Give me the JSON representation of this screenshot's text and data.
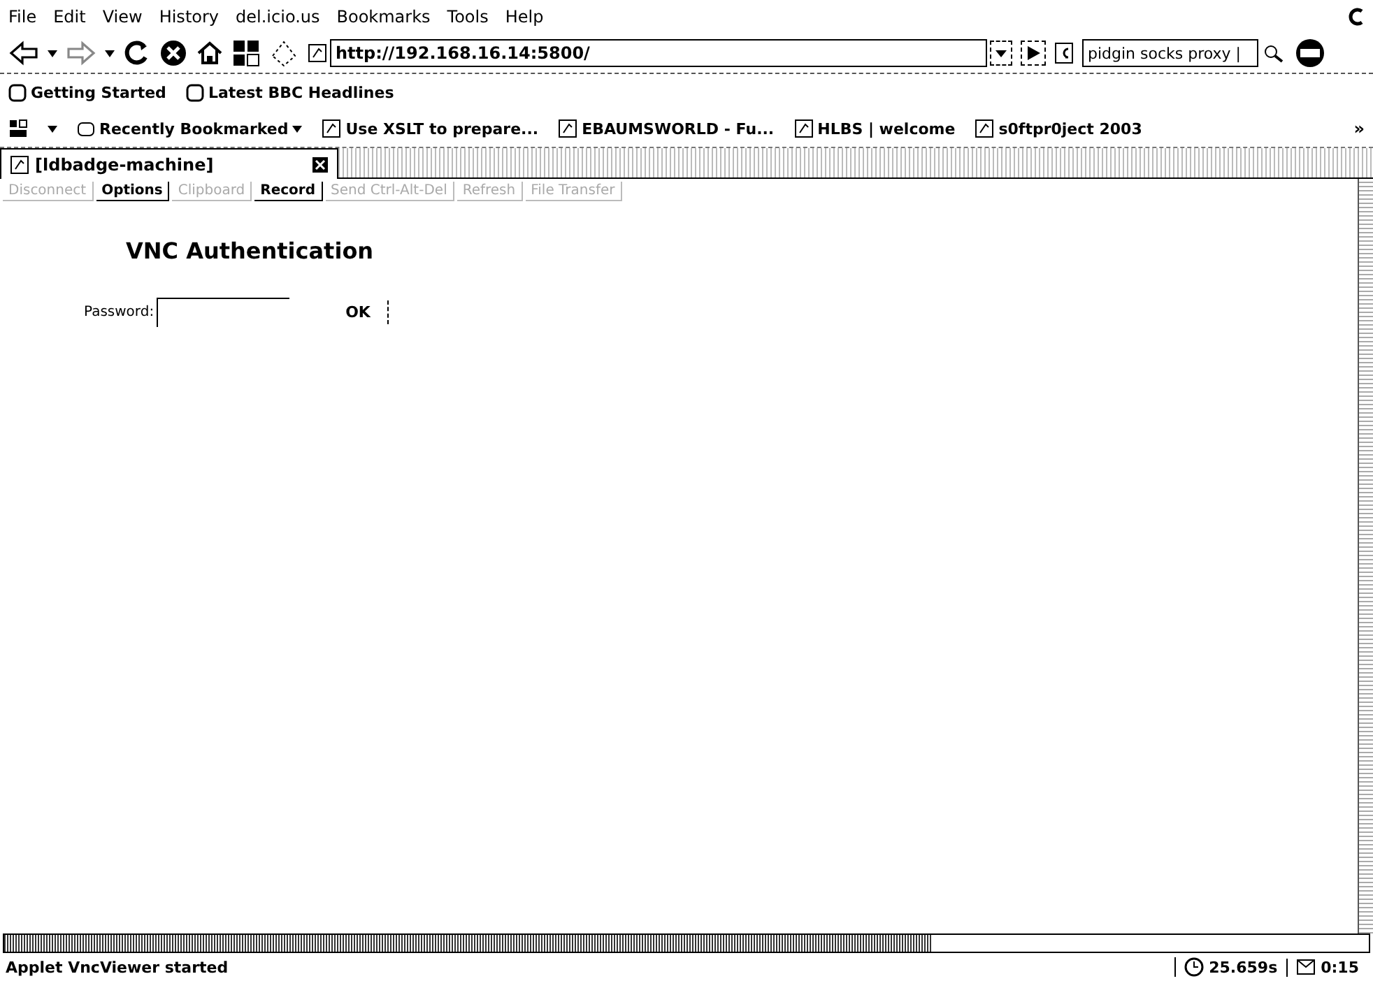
{
  "menu_bar": [
    "File",
    "Edit",
    "View",
    "History",
    "del.icio.us",
    "Bookmarks",
    "Tools",
    "Help"
  ],
  "nav_toolbar": {
    "url": "http://192.168.16.14:5800/",
    "search_value": "pidgin socks proxy |"
  },
  "bookmarks_toolbar": [
    {
      "label": "Getting Started"
    },
    {
      "label": "Latest BBC Headlines"
    }
  ],
  "bookmarks_toolbar_2": {
    "items": [
      {
        "label": "Recently Bookmarked",
        "kind": "menu"
      },
      {
        "label": "Use XSLT to prepare...",
        "kind": "page"
      },
      {
        "label": "EBAUMSWORLD - Fu...",
        "kind": "page"
      },
      {
        "label": "HLBS | welcome",
        "kind": "page"
      },
      {
        "label": "s0ftpr0ject 2003",
        "kind": "page"
      }
    ],
    "overflow": "»"
  },
  "tabs": [
    {
      "label": "[ldbadge-machine]",
      "selected": true
    }
  ],
  "applet_buttons": [
    {
      "label": "Disconnect",
      "disabled": true
    },
    {
      "label": "Options",
      "disabled": false
    },
    {
      "label": "Clipboard",
      "disabled": true
    },
    {
      "label": "Record",
      "disabled": false
    },
    {
      "label": "Send Ctrl-Alt-Del",
      "disabled": true
    },
    {
      "label": "Refresh",
      "disabled": true
    },
    {
      "label": "File Transfer",
      "disabled": true
    }
  ],
  "auth": {
    "title": "VNC Authentication",
    "password_label": "Password:",
    "ok": "OK"
  },
  "status_bar": {
    "text": "Applet VncViewer started",
    "timer": "25.659s",
    "mail": "0:15"
  }
}
